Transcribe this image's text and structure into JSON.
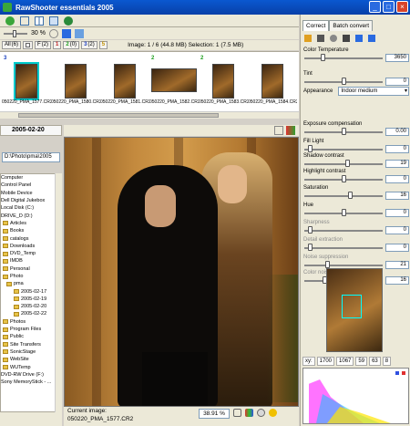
{
  "window": {
    "title": "RawShooter essentials 2005"
  },
  "toolbar": {
    "zoom": "30 %"
  },
  "filters": [
    {
      "label": "All",
      "count": "(6)"
    },
    {
      "label": "",
      "count": ""
    },
    {
      "label": "F",
      "count": "(2)"
    },
    {
      "label": "1",
      "count": ""
    },
    {
      "label": "2",
      "count": "(0)"
    },
    {
      "label": "3",
      "count": "(2)"
    },
    {
      "label": "5",
      "count": ""
    }
  ],
  "image_info": "Image: 1 / 6 (44.8 MB)   Selection: 1 (7.5 MB)",
  "thumbnails": [
    {
      "rating": "3",
      "name": "050220_PMA_1577.CR2",
      "selected": true
    },
    {
      "rating": "",
      "name": "050220_PMA_1580.CR2",
      "selected": false
    },
    {
      "rating": "",
      "name": "050220_PMA_1581.CR2",
      "selected": false
    },
    {
      "rating": "2",
      "name": "050220_PMA_1582.CR2",
      "selected": false
    },
    {
      "rating": "2",
      "name": "050220_PMA_1583.CR2",
      "selected": false
    },
    {
      "rating": "",
      "name": "050220_PMA_1584.CR2",
      "selected": false
    }
  ],
  "folder": {
    "date": "2005-02-20",
    "path": "D:\\Photo\\pma\\2005"
  },
  "tree": [
    {
      "label": "Computer",
      "indent": 0,
      "folder": false
    },
    {
      "label": "Control Panel",
      "indent": 0,
      "folder": false
    },
    {
      "label": "Mobile Device",
      "indent": 0,
      "folder": false
    },
    {
      "label": "Dell Digital Jukebox",
      "indent": 0,
      "folder": false
    },
    {
      "label": "Local Disk (C:)",
      "indent": 0,
      "folder": false
    },
    {
      "label": "DRIVE_D (D:)",
      "indent": 0,
      "folder": false
    },
    {
      "label": "Articles",
      "indent": 1,
      "folder": true
    },
    {
      "label": "Books",
      "indent": 1,
      "folder": true
    },
    {
      "label": "catalogs",
      "indent": 1,
      "folder": true
    },
    {
      "label": "Downloads",
      "indent": 1,
      "folder": true
    },
    {
      "label": "DVD_Temp",
      "indent": 1,
      "folder": true
    },
    {
      "label": "IMDB",
      "indent": 1,
      "folder": true
    },
    {
      "label": "Personal",
      "indent": 1,
      "folder": true
    },
    {
      "label": "Photo",
      "indent": 1,
      "folder": true
    },
    {
      "label": "pma",
      "indent": 2,
      "folder": true
    },
    {
      "label": "2005-02-17",
      "indent": 3,
      "folder": true
    },
    {
      "label": "2005-02-19",
      "indent": 3,
      "folder": true
    },
    {
      "label": "2005-02-20",
      "indent": 3,
      "folder": true
    },
    {
      "label": "2005-02-22",
      "indent": 3,
      "folder": true
    },
    {
      "label": "Photos",
      "indent": 1,
      "folder": true
    },
    {
      "label": "Program Files",
      "indent": 1,
      "folder": true
    },
    {
      "label": "Public",
      "indent": 1,
      "folder": true
    },
    {
      "label": "Site Transfers",
      "indent": 1,
      "folder": true
    },
    {
      "label": "SonicStage",
      "indent": 1,
      "folder": true
    },
    {
      "label": "WebSite",
      "indent": 1,
      "folder": true
    },
    {
      "label": "WUTemp",
      "indent": 1,
      "folder": true
    },
    {
      "label": "DVD-RW Drive (F:)",
      "indent": 0,
      "folder": false
    },
    {
      "label": "Sony MemoryStick - ...",
      "indent": 0,
      "folder": false
    }
  ],
  "viewer": {
    "current_label": "Current image:",
    "current_file": "050220_PMA_1577.CR2",
    "zoom": "38.91 %"
  },
  "panel": {
    "tabs": [
      "Correct",
      "Batch convert"
    ],
    "controls": [
      {
        "name": "Color Temperature",
        "value": "3650",
        "pos": 0.22,
        "dim": false
      },
      {
        "name": "Tint",
        "value": "0",
        "pos": 0.5,
        "dim": false
      },
      {
        "name": "Exposure compensation",
        "value": "0.00",
        "pos": 0.5,
        "dim": false
      },
      {
        "name": "Fill Light",
        "value": "0",
        "pos": 0.05,
        "dim": false
      },
      {
        "name": "Shadow contrast",
        "value": "19",
        "pos": 0.55,
        "dim": false
      },
      {
        "name": "Highlight contrast",
        "value": "0",
        "pos": 0.5,
        "dim": false
      },
      {
        "name": "Saturation",
        "value": "16",
        "pos": 0.58,
        "dim": false
      },
      {
        "name": "Hue",
        "value": "0",
        "pos": 0.5,
        "dim": false
      },
      {
        "name": "Sharpness",
        "value": "0",
        "pos": 0.05,
        "dim": true
      },
      {
        "name": "Detail extraction",
        "value": "0",
        "pos": 0.05,
        "dim": true
      },
      {
        "name": "Noise suppression",
        "value": "21",
        "pos": 0.28,
        "dim": true
      },
      {
        "name": "Color noise suppression",
        "value": "16",
        "pos": 0.24,
        "dim": true
      }
    ],
    "appearance": {
      "label": "Appearance",
      "value": "Indoor medium"
    },
    "coords": [
      "xy:",
      "1700",
      "1067",
      "59",
      "63",
      "8"
    ]
  },
  "colors": {
    "titlebar": "#0a58d0",
    "panel": "#ece9d8",
    "selection": "#00cccc"
  }
}
